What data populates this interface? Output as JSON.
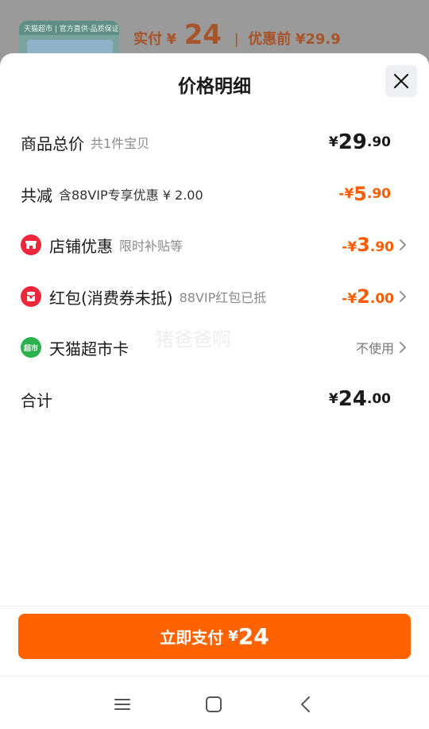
{
  "background": {
    "thumb_text": "天猫超市 | 官方直供·品质保证",
    "price_label": "实付",
    "currency": "¥",
    "price": "24",
    "separator": "|",
    "orig_label": "优惠前",
    "orig_price": "¥29.9"
  },
  "sheet": {
    "title": "价格明细"
  },
  "rows": {
    "total": {
      "label": "商品总价",
      "sub": "共1件宝贝",
      "cur": "¥",
      "int": "29",
      "dec": ".90"
    },
    "reduce": {
      "label": "共减",
      "sub": "含88VIP专享优惠 ¥ 2.00",
      "cur": "-¥",
      "int": "5",
      "dec": ".90"
    },
    "store": {
      "label": "店铺优惠",
      "sub": "限时补贴等",
      "cur": "-¥",
      "int": "3",
      "dec": ".90",
      "icon": "store-icon"
    },
    "redpack": {
      "label": "红包(消费券未抵)",
      "sub": "88VIP红包已抵",
      "cur": "-¥",
      "int": "2",
      "dec": ".00",
      "icon": "red-packet-icon"
    },
    "card": {
      "label": "天猫超市卡",
      "icon_text": "超市",
      "status": "不使用",
      "icon": "supermarket-card-icon"
    },
    "sum": {
      "label": "合计",
      "cur": "¥",
      "int": "24",
      "dec": ".00"
    }
  },
  "watermark": "猪爸爸啊",
  "pay": {
    "label": "立即支付",
    "cur": "¥",
    "amount": "24"
  },
  "colors": {
    "accent": "#ff6200",
    "discount": "#ff5b00",
    "store_icon": "#f0263a",
    "card_icon": "#2bb24c"
  }
}
